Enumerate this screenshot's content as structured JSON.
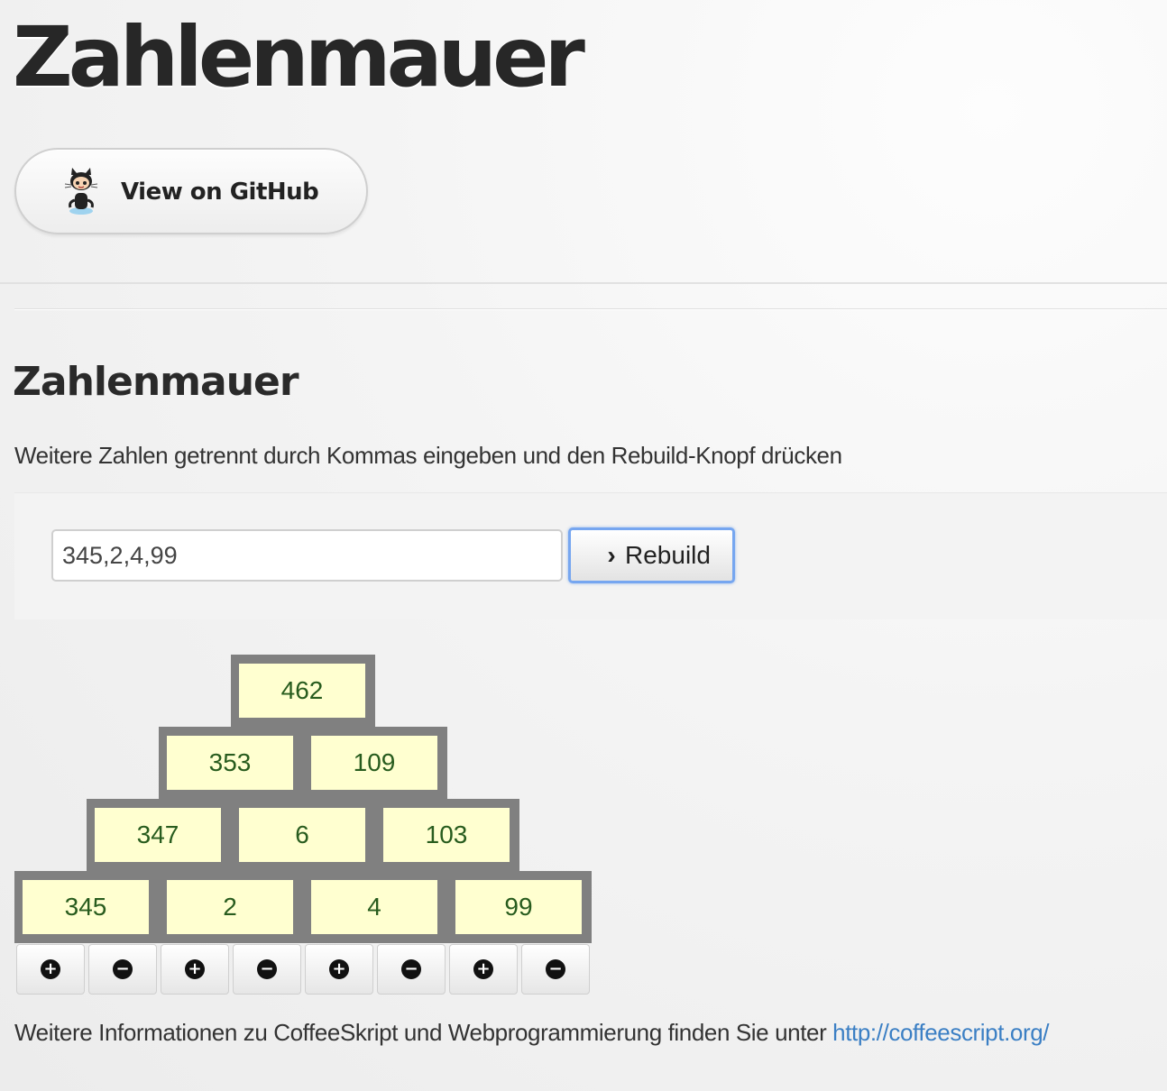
{
  "header": {
    "title": "Zahlenmauer",
    "github_button": "View on GitHub",
    "github_icon": "octocat-icon"
  },
  "section": {
    "title": "Zahlenmauer",
    "instructions": "Weitere Zahlen getrennt durch Kommas eingeben und den Rebuild-Knopf drücken"
  },
  "form": {
    "input_value": "345,2,4,99",
    "rebuild_label": "Rebuild",
    "rebuild_icon": "chevron-right-icon"
  },
  "wall": {
    "rows": [
      [
        "462"
      ],
      [
        "353",
        "109"
      ],
      [
        "347",
        "6",
        "103"
      ],
      [
        "345",
        "2",
        "4",
        "99"
      ]
    ],
    "brick_color": "#ffffd0",
    "mortar_color": "#808080",
    "number_color": "#285c1e"
  },
  "controls": [
    {
      "symbol": "+",
      "icon": "plus-circle-icon"
    },
    {
      "symbol": "−",
      "icon": "minus-circle-icon"
    },
    {
      "symbol": "+",
      "icon": "plus-circle-icon"
    },
    {
      "symbol": "−",
      "icon": "minus-circle-icon"
    },
    {
      "symbol": "+",
      "icon": "plus-circle-icon"
    },
    {
      "symbol": "−",
      "icon": "minus-circle-icon"
    },
    {
      "symbol": "+",
      "icon": "plus-circle-icon"
    },
    {
      "symbol": "−",
      "icon": "minus-circle-icon"
    }
  ],
  "footer": {
    "text": "Weitere Informationen zu CoffeeSkript und Webprogrammierung finden Sie unter ",
    "link_text": "http://coffeescript.org/"
  },
  "colors": {
    "link": "#3b7fc4",
    "focus_ring": "#76a6f0"
  }
}
